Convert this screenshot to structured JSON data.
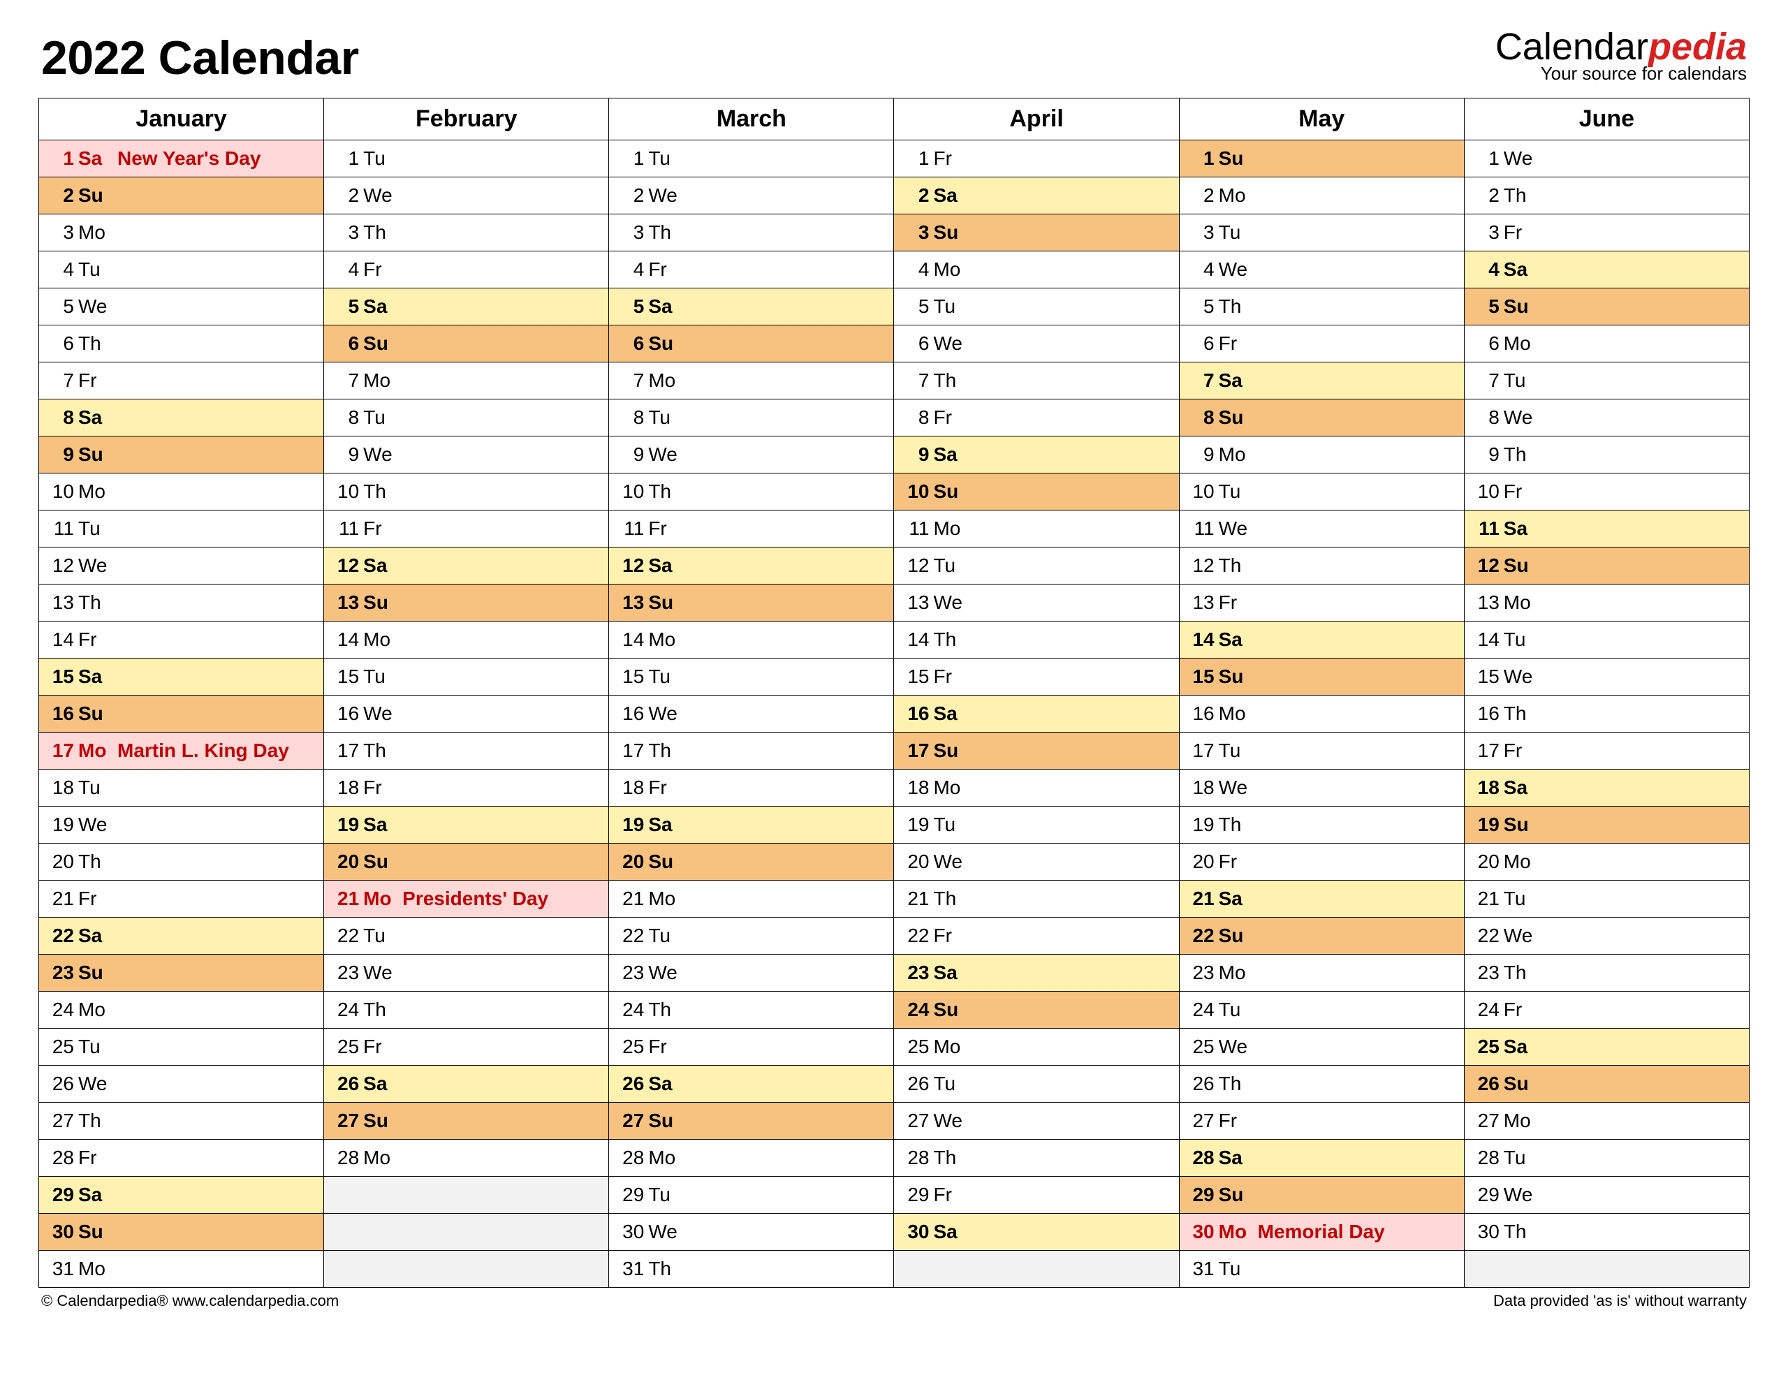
{
  "header": {
    "title": "2022 Calendar",
    "brand_main_plain": "Calendar",
    "brand_main_accent": "pedia",
    "brand_subtitle": "Your source for calendars"
  },
  "footer": {
    "left": "© Calendarpedia®   www.calendarpedia.com",
    "right": "Data provided 'as is' without warranty"
  },
  "dow_labels": {
    "0": "Su",
    "1": "Mo",
    "2": "Tu",
    "3": "We",
    "4": "Th",
    "5": "Fr",
    "6": "Sa"
  },
  "months": [
    {
      "name": "January",
      "days": [
        {
          "n": 1,
          "w": 6,
          "holiday": "New Year's Day"
        },
        {
          "n": 2,
          "w": 0
        },
        {
          "n": 3,
          "w": 1
        },
        {
          "n": 4,
          "w": 2
        },
        {
          "n": 5,
          "w": 3
        },
        {
          "n": 6,
          "w": 4
        },
        {
          "n": 7,
          "w": 5
        },
        {
          "n": 8,
          "w": 6
        },
        {
          "n": 9,
          "w": 0
        },
        {
          "n": 10,
          "w": 1
        },
        {
          "n": 11,
          "w": 2
        },
        {
          "n": 12,
          "w": 3
        },
        {
          "n": 13,
          "w": 4
        },
        {
          "n": 14,
          "w": 5
        },
        {
          "n": 15,
          "w": 6
        },
        {
          "n": 16,
          "w": 0
        },
        {
          "n": 17,
          "w": 1,
          "holiday": "Martin L. King Day"
        },
        {
          "n": 18,
          "w": 2
        },
        {
          "n": 19,
          "w": 3
        },
        {
          "n": 20,
          "w": 4
        },
        {
          "n": 21,
          "w": 5
        },
        {
          "n": 22,
          "w": 6
        },
        {
          "n": 23,
          "w": 0
        },
        {
          "n": 24,
          "w": 1
        },
        {
          "n": 25,
          "w": 2
        },
        {
          "n": 26,
          "w": 3
        },
        {
          "n": 27,
          "w": 4
        },
        {
          "n": 28,
          "w": 5
        },
        {
          "n": 29,
          "w": 6
        },
        {
          "n": 30,
          "w": 0
        },
        {
          "n": 31,
          "w": 1
        }
      ]
    },
    {
      "name": "February",
      "days": [
        {
          "n": 1,
          "w": 2
        },
        {
          "n": 2,
          "w": 3
        },
        {
          "n": 3,
          "w": 4
        },
        {
          "n": 4,
          "w": 5
        },
        {
          "n": 5,
          "w": 6
        },
        {
          "n": 6,
          "w": 0
        },
        {
          "n": 7,
          "w": 1
        },
        {
          "n": 8,
          "w": 2
        },
        {
          "n": 9,
          "w": 3
        },
        {
          "n": 10,
          "w": 4
        },
        {
          "n": 11,
          "w": 5
        },
        {
          "n": 12,
          "w": 6
        },
        {
          "n": 13,
          "w": 0
        },
        {
          "n": 14,
          "w": 1
        },
        {
          "n": 15,
          "w": 2
        },
        {
          "n": 16,
          "w": 3
        },
        {
          "n": 17,
          "w": 4
        },
        {
          "n": 18,
          "w": 5
        },
        {
          "n": 19,
          "w": 6
        },
        {
          "n": 20,
          "w": 0
        },
        {
          "n": 21,
          "w": 1,
          "holiday": "Presidents' Day"
        },
        {
          "n": 22,
          "w": 2
        },
        {
          "n": 23,
          "w": 3
        },
        {
          "n": 24,
          "w": 4
        },
        {
          "n": 25,
          "w": 5
        },
        {
          "n": 26,
          "w": 6
        },
        {
          "n": 27,
          "w": 0
        },
        {
          "n": 28,
          "w": 1
        }
      ]
    },
    {
      "name": "March",
      "days": [
        {
          "n": 1,
          "w": 2
        },
        {
          "n": 2,
          "w": 3
        },
        {
          "n": 3,
          "w": 4
        },
        {
          "n": 4,
          "w": 5
        },
        {
          "n": 5,
          "w": 6
        },
        {
          "n": 6,
          "w": 0
        },
        {
          "n": 7,
          "w": 1
        },
        {
          "n": 8,
          "w": 2
        },
        {
          "n": 9,
          "w": 3
        },
        {
          "n": 10,
          "w": 4
        },
        {
          "n": 11,
          "w": 5
        },
        {
          "n": 12,
          "w": 6
        },
        {
          "n": 13,
          "w": 0
        },
        {
          "n": 14,
          "w": 1
        },
        {
          "n": 15,
          "w": 2
        },
        {
          "n": 16,
          "w": 3
        },
        {
          "n": 17,
          "w": 4
        },
        {
          "n": 18,
          "w": 5
        },
        {
          "n": 19,
          "w": 6
        },
        {
          "n": 20,
          "w": 0
        },
        {
          "n": 21,
          "w": 1
        },
        {
          "n": 22,
          "w": 2
        },
        {
          "n": 23,
          "w": 3
        },
        {
          "n": 24,
          "w": 4
        },
        {
          "n": 25,
          "w": 5
        },
        {
          "n": 26,
          "w": 6
        },
        {
          "n": 27,
          "w": 0
        },
        {
          "n": 28,
          "w": 1
        },
        {
          "n": 29,
          "w": 2
        },
        {
          "n": 30,
          "w": 3
        },
        {
          "n": 31,
          "w": 4
        }
      ]
    },
    {
      "name": "April",
      "days": [
        {
          "n": 1,
          "w": 5
        },
        {
          "n": 2,
          "w": 6
        },
        {
          "n": 3,
          "w": 0
        },
        {
          "n": 4,
          "w": 1
        },
        {
          "n": 5,
          "w": 2
        },
        {
          "n": 6,
          "w": 3
        },
        {
          "n": 7,
          "w": 4
        },
        {
          "n": 8,
          "w": 5
        },
        {
          "n": 9,
          "w": 6
        },
        {
          "n": 10,
          "w": 0
        },
        {
          "n": 11,
          "w": 1
        },
        {
          "n": 12,
          "w": 2
        },
        {
          "n": 13,
          "w": 3
        },
        {
          "n": 14,
          "w": 4
        },
        {
          "n": 15,
          "w": 5
        },
        {
          "n": 16,
          "w": 6
        },
        {
          "n": 17,
          "w": 0
        },
        {
          "n": 18,
          "w": 1
        },
        {
          "n": 19,
          "w": 2
        },
        {
          "n": 20,
          "w": 3
        },
        {
          "n": 21,
          "w": 4
        },
        {
          "n": 22,
          "w": 5
        },
        {
          "n": 23,
          "w": 6
        },
        {
          "n": 24,
          "w": 0
        },
        {
          "n": 25,
          "w": 1
        },
        {
          "n": 26,
          "w": 2
        },
        {
          "n": 27,
          "w": 3
        },
        {
          "n": 28,
          "w": 4
        },
        {
          "n": 29,
          "w": 5
        },
        {
          "n": 30,
          "w": 6
        }
      ]
    },
    {
      "name": "May",
      "days": [
        {
          "n": 1,
          "w": 0
        },
        {
          "n": 2,
          "w": 1
        },
        {
          "n": 3,
          "w": 2
        },
        {
          "n": 4,
          "w": 3
        },
        {
          "n": 5,
          "w": 4
        },
        {
          "n": 6,
          "w": 5
        },
        {
          "n": 7,
          "w": 6
        },
        {
          "n": 8,
          "w": 0
        },
        {
          "n": 9,
          "w": 1
        },
        {
          "n": 10,
          "w": 2
        },
        {
          "n": 11,
          "w": 3
        },
        {
          "n": 12,
          "w": 4
        },
        {
          "n": 13,
          "w": 5
        },
        {
          "n": 14,
          "w": 6
        },
        {
          "n": 15,
          "w": 0
        },
        {
          "n": 16,
          "w": 1
        },
        {
          "n": 17,
          "w": 2
        },
        {
          "n": 18,
          "w": 3
        },
        {
          "n": 19,
          "w": 4
        },
        {
          "n": 20,
          "w": 5
        },
        {
          "n": 21,
          "w": 6
        },
        {
          "n": 22,
          "w": 0
        },
        {
          "n": 23,
          "w": 1
        },
        {
          "n": 24,
          "w": 2
        },
        {
          "n": 25,
          "w": 3
        },
        {
          "n": 26,
          "w": 4
        },
        {
          "n": 27,
          "w": 5
        },
        {
          "n": 28,
          "w": 6
        },
        {
          "n": 29,
          "w": 0
        },
        {
          "n": 30,
          "w": 1,
          "holiday": "Memorial Day"
        },
        {
          "n": 31,
          "w": 2
        }
      ]
    },
    {
      "name": "June",
      "days": [
        {
          "n": 1,
          "w": 3
        },
        {
          "n": 2,
          "w": 4
        },
        {
          "n": 3,
          "w": 5
        },
        {
          "n": 4,
          "w": 6
        },
        {
          "n": 5,
          "w": 0
        },
        {
          "n": 6,
          "w": 1
        },
        {
          "n": 7,
          "w": 2
        },
        {
          "n": 8,
          "w": 3
        },
        {
          "n": 9,
          "w": 4
        },
        {
          "n": 10,
          "w": 5
        },
        {
          "n": 11,
          "w": 6
        },
        {
          "n": 12,
          "w": 0
        },
        {
          "n": 13,
          "w": 1
        },
        {
          "n": 14,
          "w": 2
        },
        {
          "n": 15,
          "w": 3
        },
        {
          "n": 16,
          "w": 4
        },
        {
          "n": 17,
          "w": 5
        },
        {
          "n": 18,
          "w": 6
        },
        {
          "n": 19,
          "w": 0
        },
        {
          "n": 20,
          "w": 1
        },
        {
          "n": 21,
          "w": 2
        },
        {
          "n": 22,
          "w": 3
        },
        {
          "n": 23,
          "w": 4
        },
        {
          "n": 24,
          "w": 5
        },
        {
          "n": 25,
          "w": 6
        },
        {
          "n": 26,
          "w": 0
        },
        {
          "n": 27,
          "w": 1
        },
        {
          "n": 28,
          "w": 2
        },
        {
          "n": 29,
          "w": 3
        },
        {
          "n": 30,
          "w": 4
        }
      ]
    }
  ]
}
